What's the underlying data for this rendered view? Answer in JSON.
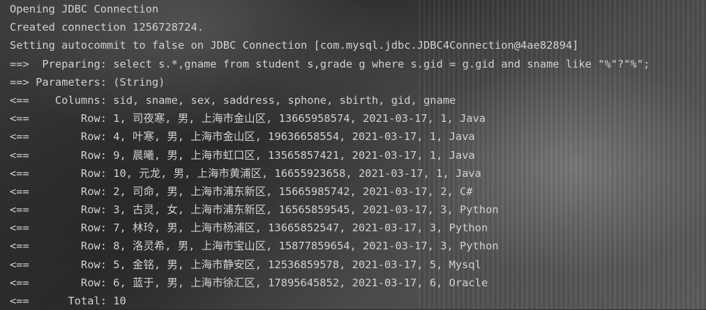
{
  "console": {
    "lines": [
      "Opening JDBC Connection",
      "Created connection 1256728724.",
      "Setting autocommit to false on JDBC Connection [com.mysql.jdbc.JDBC4Connection@4ae82894]",
      "==>  Preparing: select s.*,gname from student s,grade g where s.gid = g.gid and sname like \"%\"?\"%\";",
      "==> Parameters: (String)",
      "<==    Columns: sid, sname, sex, saddress, sphone, sbirth, gid, gname",
      "<==        Row: 1, 司夜寒, 男, 上海市金山区, 13665958574, 2021-03-17, 1, Java",
      "<==        Row: 4, 叶寒, 男, 上海市金山区, 19636658554, 2021-03-17, 1, Java",
      "<==        Row: 9, 晨曦, 男, 上海市虹口区, 13565857421, 2021-03-17, 1, Java",
      "<==        Row: 10, 元龙, 男, 上海市黄浦区, 16655923658, 2021-03-17, 1, Java",
      "<==        Row: 2, 司命, 男, 上海市浦东新区, 15665985742, 2021-03-17, 2, C#",
      "<==        Row: 3, 古灵, 女, 上海市浦东新区, 16565859545, 2021-03-17, 3, Python",
      "<==        Row: 7, 林玲, 男, 上海市杨浦区, 13665852547, 2021-03-17, 3, Python",
      "<==        Row: 8, 洛灵希, 男, 上海市宝山区, 15877859654, 2021-03-17, 3, Python",
      "<==        Row: 5, 金铭, 男, 上海市静安区, 12536859578, 2021-03-17, 5, Mysql",
      "<==        Row: 6, 蓝于, 男, 上海市徐汇区, 17895645852, 2021-03-17, 6, Oracle",
      "<==      Total: 10"
    ]
  }
}
